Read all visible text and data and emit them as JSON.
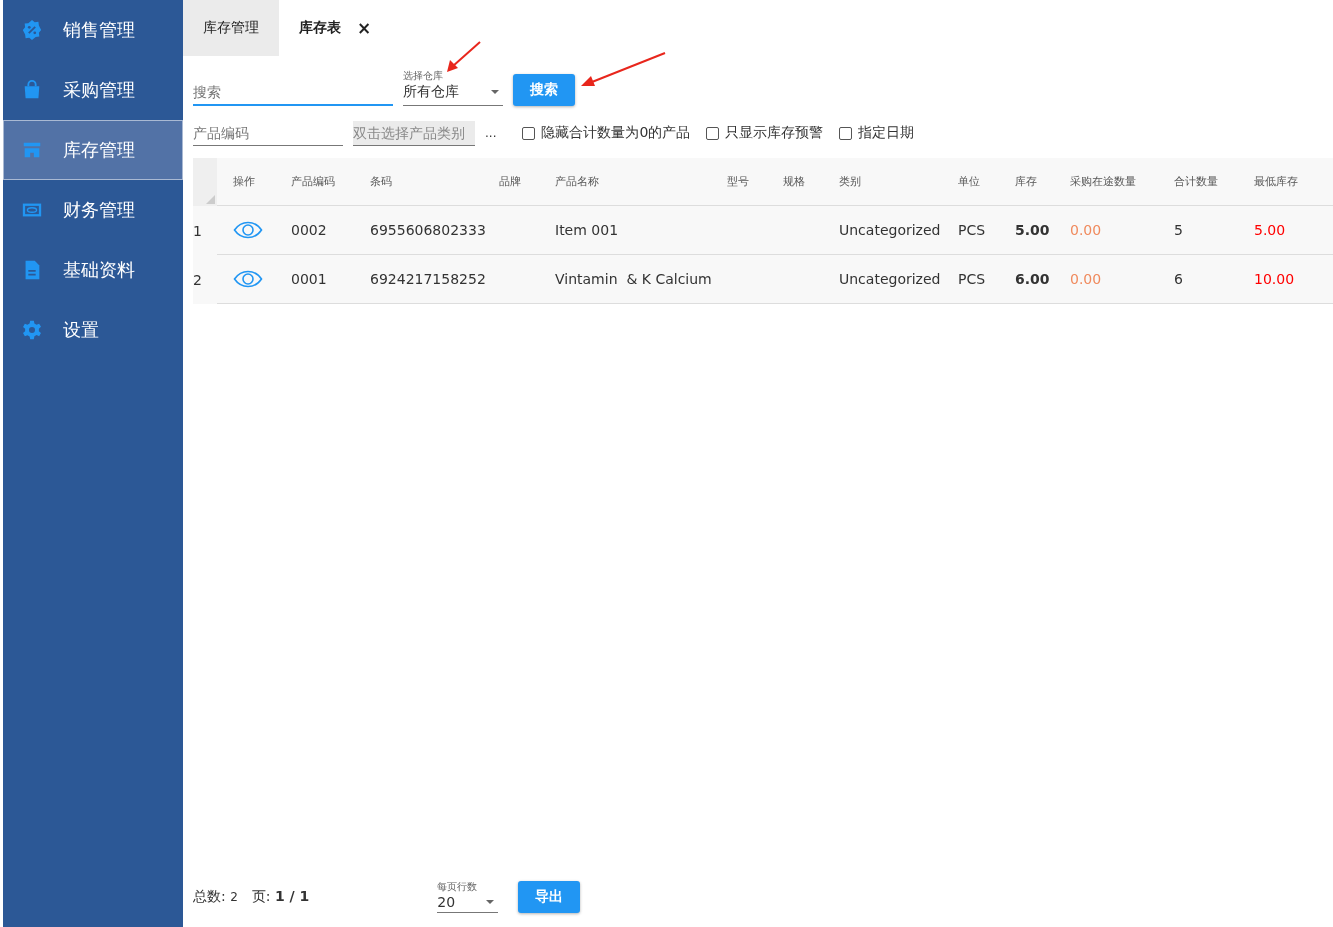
{
  "sidebar": {
    "items": [
      {
        "label": "销售管理",
        "kind": "badge",
        "selected": false
      },
      {
        "label": "采购管理",
        "kind": "bag",
        "selected": false
      },
      {
        "label": "库存管理",
        "kind": "store",
        "selected": true
      },
      {
        "label": "财务管理",
        "kind": "money",
        "selected": false
      },
      {
        "label": "基础资料",
        "kind": "doc",
        "selected": false
      },
      {
        "label": "设置",
        "kind": "gear",
        "selected": false
      }
    ]
  },
  "tabs": [
    {
      "label": "库存管理",
      "selected": false
    },
    {
      "label": "库存表",
      "selected": true,
      "close": "×"
    }
  ],
  "filters": {
    "search": {
      "placeholder": "搜索"
    },
    "warehouse": {
      "label": "选择仓库",
      "value": "所有仓库"
    },
    "search_button": "搜索",
    "product_code": {
      "placeholder": "产品编码"
    },
    "category": {
      "placeholder": "双击选择产品类别"
    },
    "more": "...",
    "checkboxes": [
      {
        "label": "隐藏合计数量为0的产品",
        "checked": false
      },
      {
        "label": "只显示库存预警",
        "checked": false
      },
      {
        "label": "指定日期",
        "checked": false
      }
    ]
  },
  "table": {
    "columns": [
      "操作",
      "产品编码",
      "条码",
      "品牌",
      "产品名称",
      "型号",
      "规格",
      "类别",
      "单位",
      "库存",
      "采购在途数量",
      "合计数量",
      "最低库存"
    ],
    "rows": [
      {
        "index": "1",
        "cells": [
          "",
          "0002",
          "6955606802333",
          "",
          "Item 001",
          "",
          "",
          "Uncategorized",
          "PCS",
          "5.00",
          "0.00",
          "5",
          "5.00"
        ]
      },
      {
        "index": "2",
        "cells": [
          "",
          "0001",
          "6924217158252",
          "",
          "Vintamin  & K Calcium",
          "",
          "",
          "Uncategorized",
          "PCS",
          "6.00",
          "0.00",
          "6",
          "10.00"
        ]
      }
    ]
  },
  "footer": {
    "total_label": "总数:",
    "total": "2",
    "page": "页: **1 / 1**",
    "page_size": {
      "label": "每页行数",
      "value": "20"
    },
    "export_button": "导出"
  }
}
